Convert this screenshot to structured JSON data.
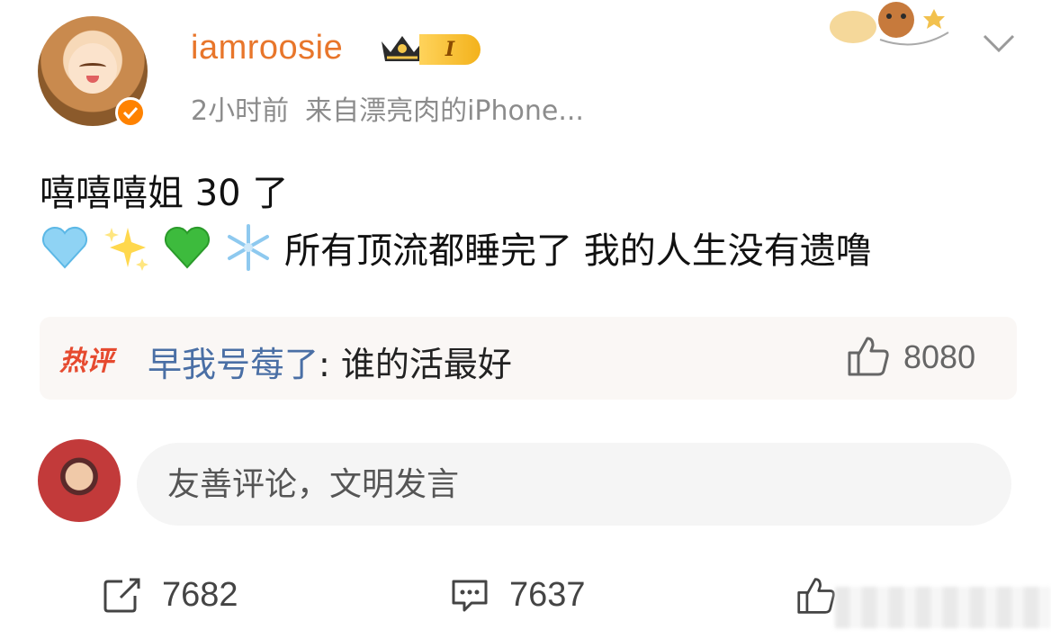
{
  "post": {
    "author": {
      "username": "iamroosie",
      "level": "I"
    },
    "meta": {
      "time": "2小时前",
      "source": "来自漂亮肉的iPhone..."
    },
    "content": {
      "line1": "嘻嘻嘻姐 30 了",
      "line2_text": "所有顶流都睡完了 我的人生没有遗噜",
      "emojis": [
        "light-blue-heart-icon",
        "sparkles-icon",
        "green-heart-icon",
        "snowflake-icon"
      ]
    }
  },
  "hot_comment": {
    "tag": "热评",
    "author": "早我号莓了",
    "separator": ": ",
    "text": "谁的活最好",
    "likes": "8080"
  },
  "comment_input": {
    "placeholder": "友善评论，文明发言"
  },
  "actions": {
    "repost_count": "7682",
    "comment_count": "7637"
  },
  "colors": {
    "username": "#e8762b",
    "hot_tag": "#e64a2f",
    "comment_author": "#4a6fa5",
    "verify": "#ff8200"
  }
}
